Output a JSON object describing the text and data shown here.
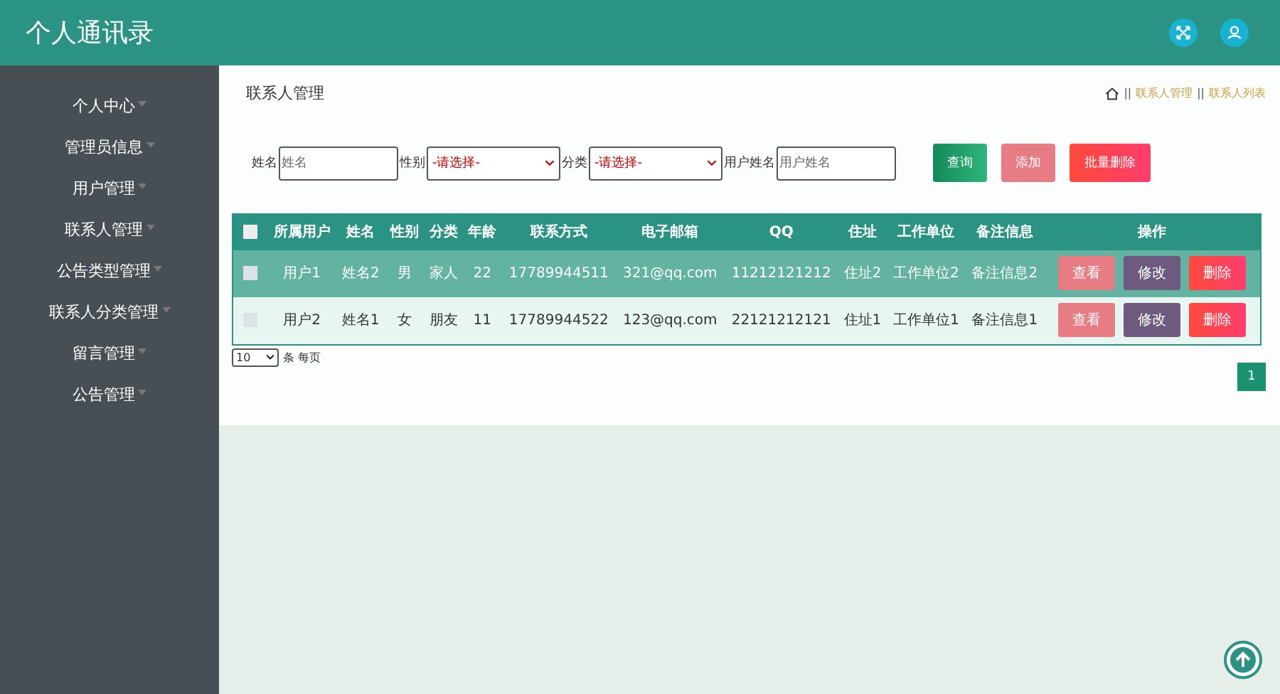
{
  "header": {
    "title": "个人通讯录"
  },
  "sidebar": {
    "items": [
      {
        "label": "个人中心"
      },
      {
        "label": "管理员信息"
      },
      {
        "label": "用户管理"
      },
      {
        "label": "联系人管理"
      },
      {
        "label": "公告类型管理"
      },
      {
        "label": "联系人分类管理"
      },
      {
        "label": "留言管理"
      },
      {
        "label": "公告管理"
      }
    ]
  },
  "page_title": "联系人管理",
  "breadcrumb": [
    {
      "separator": "||",
      "label": "联系人管理"
    },
    {
      "separator": "||",
      "label": "联系人列表"
    }
  ],
  "search": {
    "fields": [
      {
        "kind": "input",
        "label": "姓名",
        "placeholder": "姓名"
      },
      {
        "kind": "select",
        "label": "性别",
        "value": "-请选择-"
      },
      {
        "kind": "select",
        "label": "分类",
        "value": "-请选择-"
      },
      {
        "kind": "input",
        "label": "用户姓名",
        "placeholder": "用户姓名"
      }
    ],
    "buttons": [
      {
        "kind": "search",
        "label": "查询"
      },
      {
        "kind": "add",
        "label": "添加"
      },
      {
        "kind": "delete",
        "label": "批量删除"
      }
    ]
  },
  "table": {
    "select_all_checked": false,
    "columns": [
      "所属用户",
      "姓名",
      "性别",
      "分类",
      "年龄",
      "联系方式",
      "电子邮箱",
      "QQ",
      "住址",
      "工作单位",
      "备注信息",
      "操作"
    ],
    "rows": [
      {
        "selected": true,
        "checked": false,
        "cells": [
          "用户1",
          "姓名2",
          "男",
          "家人",
          "22",
          "17789944511",
          "321@qq.com",
          "11212121212",
          "住址2",
          "工作单位2",
          "备注信息2"
        ],
        "actions": [
          "查看",
          "修改",
          "删除"
        ]
      },
      {
        "selected": false,
        "checked": false,
        "cells": [
          "用户2",
          "姓名1",
          "女",
          "朋友",
          "11",
          "17789944522",
          "123@qq.com",
          "22121212121",
          "住址1",
          "工作单位1",
          "备注信息1"
        ],
        "actions": [
          "查看",
          "修改",
          "删除"
        ]
      }
    ]
  },
  "pagination": {
    "page_size": "10",
    "page_size_label": "条 每页",
    "pages": [
      {
        "label": "1",
        "selected": true
      }
    ]
  }
}
